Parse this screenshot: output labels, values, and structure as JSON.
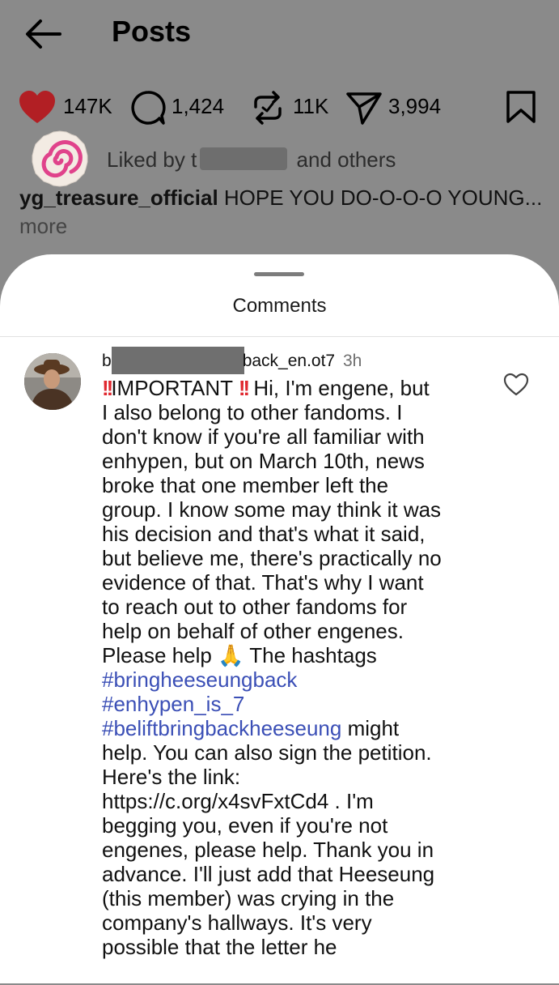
{
  "header": {
    "title": "Posts"
  },
  "actions": {
    "likes": "147K",
    "comments": "1,424",
    "reposts": "11K",
    "shares": "3,994"
  },
  "liked_by": {
    "prefix": "Liked by",
    "name_first": "t",
    "suffix": "and others"
  },
  "caption": {
    "username": "yg_treasure_official",
    "text": "HOPE YOU DO-O-O-O YOUNG...",
    "more": "more"
  },
  "comments_sheet": {
    "title": "Comments",
    "comment": {
      "username_visible_start": "b",
      "username_visible_end": "back_en.ot7",
      "time": "3h",
      "first_line": {
        "after_bang1": "IMPORTANT",
        "after_bang2": " Hi, I'm engene, but"
      },
      "lines_part1": [
        "I also belong to other fandoms. I",
        "don't know if you're all familiar with",
        "enhypen, but on March 10th, news",
        "broke that one member left the",
        "group. I know some may think it was",
        "his decision and that's what it said,",
        "but believe me, there's practically no",
        "evidence of that. That's why I want",
        "to reach out to other fandoms for",
        "help on behalf of other engenes."
      ],
      "help_line": {
        "before": "Please help ",
        "emoji": "🙏",
        "after": " The hashtags"
      },
      "hashtags": [
        "#bringheeseungback",
        "#enhypen_is_7",
        "#beliftbringbackheeseung"
      ],
      "after_hashtags": " might",
      "lines_part2": [
        "help. You can also sign the petition.",
        "Here's the link:",
        "https://c.org/x4svFxtCd4 . I'm",
        "begging you, even if you're not",
        "engenes, please help. Thank you in",
        "advance. I'll just add that Heeseung",
        "(this member) was crying in the",
        "company's hallways. It's very",
        "possible that the letter he"
      ]
    }
  },
  "colors": {
    "hashtag": "#3b4fb6",
    "like_red": "#c62828",
    "bang_red": "#e0282f"
  }
}
